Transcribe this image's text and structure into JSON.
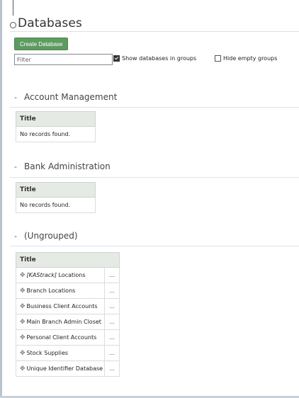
{
  "page": {
    "title": "Databases"
  },
  "toolbar": {
    "create_label": "Create Database",
    "filter_placeholder": "Filter",
    "show_groups_label": "Show databases in groups",
    "show_groups_checked": true,
    "hide_empty_label": "Hide empty groups",
    "hide_empty_checked": false
  },
  "groups": [
    {
      "toggle": "-",
      "name": "Account Management",
      "column": "Title",
      "empty_text": "No records found."
    },
    {
      "toggle": "-",
      "name": "Bank Administration",
      "column": "Title",
      "empty_text": "No records found."
    },
    {
      "toggle": "-",
      "name": "(Ungrouped)",
      "column": "Title",
      "rows": [
        {
          "prefix": "[KAStrack]",
          "name": " Locations",
          "menu": "..."
        },
        {
          "prefix": "",
          "name": "Branch Locations",
          "menu": "..."
        },
        {
          "prefix": "",
          "name": "Business Client Accounts",
          "menu": "..."
        },
        {
          "prefix": "",
          "name": "Main Branch Admin Closet",
          "menu": "..."
        },
        {
          "prefix": "",
          "name": "Personal Client Accounts",
          "menu": "..."
        },
        {
          "prefix": "",
          "name": "Stock Supplies",
          "menu": "..."
        },
        {
          "prefix": "",
          "name": "Unique Identifier Database",
          "menu": "..."
        }
      ]
    }
  ],
  "icons": {
    "drag_handle": "move-handle-icon",
    "row_menu": "ellipsis-icon"
  }
}
